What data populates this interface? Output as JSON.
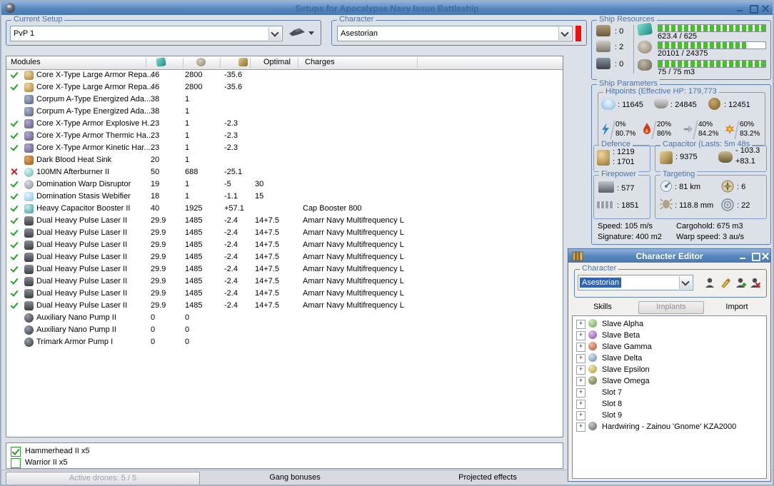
{
  "window": {
    "title": "Setups for Apocalypse Navy Issue Battleship",
    "setup_group": {
      "label": "Current Setup",
      "value": "PvP 1"
    },
    "character_group": {
      "label": "Character",
      "value": "Asestorian"
    },
    "modules": {
      "header": {
        "modules": "Modules",
        "optimal": "Optimal",
        "charges": "Charges",
        "icons": [
          "cpu-icon",
          "powergrid-icon",
          "capacitor-icon"
        ]
      },
      "rows": [
        {
          "s": "ok",
          "i": "rep",
          "n": "Core X-Type Large Armor Repa...",
          "cpu": "46",
          "pg": "2800",
          "cap": "-35.6",
          "opt": "",
          "chg": ""
        },
        {
          "s": "ok",
          "i": "rep",
          "n": "Core X-Type Large Armor Repa...",
          "cpu": "46",
          "pg": "2800",
          "cap": "-35.6",
          "opt": "",
          "chg": ""
        },
        {
          "s": "",
          "i": "mem",
          "n": "Corpum A-Type Energized Ada...",
          "cpu": "38",
          "pg": "1",
          "cap": "",
          "opt": "",
          "chg": ""
        },
        {
          "s": "",
          "i": "mem",
          "n": "Corpum A-Type Energized Ada...",
          "cpu": "38",
          "pg": "1",
          "cap": "",
          "opt": "",
          "chg": ""
        },
        {
          "s": "ok",
          "i": "hard",
          "n": "Core X-Type Armor Explosive H...",
          "cpu": "23",
          "pg": "1",
          "cap": "-2.3",
          "opt": "",
          "chg": ""
        },
        {
          "s": "ok",
          "i": "hard",
          "n": "Core X-Type Armor Thermic Ha...",
          "cpu": "23",
          "pg": "1",
          "cap": "-2.3",
          "opt": "",
          "chg": ""
        },
        {
          "s": "ok",
          "i": "hard",
          "n": "Core X-Type Armor Kinetic Har...",
          "cpu": "23",
          "pg": "1",
          "cap": "-2.3",
          "opt": "",
          "chg": ""
        },
        {
          "s": "",
          "i": "hs",
          "n": "Dark Blood Heat Sink",
          "cpu": "20",
          "pg": "1",
          "cap": "",
          "opt": "",
          "chg": ""
        },
        {
          "s": "bad",
          "i": "ab",
          "n": "100MN Afterburner II",
          "cpu": "50",
          "pg": "688",
          "cap": "-25.1",
          "opt": "",
          "chg": ""
        },
        {
          "s": "ok",
          "i": "wd",
          "n": "Domination Warp Disruptor",
          "cpu": "19",
          "pg": "1",
          "cap": "-5",
          "opt": "30",
          "chg": ""
        },
        {
          "s": "ok",
          "i": "web",
          "n": "Domination Stasis Webifier",
          "cpu": "18",
          "pg": "1",
          "cap": "-1.1",
          "opt": "15",
          "chg": ""
        },
        {
          "s": "ok",
          "i": "cbst",
          "n": "Heavy Capacitor Booster II",
          "cpu": "40",
          "pg": "1925",
          "cap": "+57.1",
          "opt": "",
          "chg": "Cap Booster 800"
        },
        {
          "s": "ok",
          "i": "laser",
          "n": "Dual Heavy Pulse Laser II",
          "cpu": "29.9",
          "pg": "1485",
          "cap": "-2.4",
          "opt": "14+7.5",
          "chg": "Amarr Navy Multifrequency L"
        },
        {
          "s": "ok",
          "i": "laser",
          "n": "Dual Heavy Pulse Laser II",
          "cpu": "29.9",
          "pg": "1485",
          "cap": "-2.4",
          "opt": "14+7.5",
          "chg": "Amarr Navy Multifrequency L"
        },
        {
          "s": "ok",
          "i": "laser",
          "n": "Dual Heavy Pulse Laser II",
          "cpu": "29.9",
          "pg": "1485",
          "cap": "-2.4",
          "opt": "14+7.5",
          "chg": "Amarr Navy Multifrequency L"
        },
        {
          "s": "ok",
          "i": "laser",
          "n": "Dual Heavy Pulse Laser II",
          "cpu": "29.9",
          "pg": "1485",
          "cap": "-2.4",
          "opt": "14+7.5",
          "chg": "Amarr Navy Multifrequency L"
        },
        {
          "s": "ok",
          "i": "laser",
          "n": "Dual Heavy Pulse Laser II",
          "cpu": "29.9",
          "pg": "1485",
          "cap": "-2.4",
          "opt": "14+7.5",
          "chg": "Amarr Navy Multifrequency L"
        },
        {
          "s": "ok",
          "i": "laser",
          "n": "Dual Heavy Pulse Laser II",
          "cpu": "29.9",
          "pg": "1485",
          "cap": "-2.4",
          "opt": "14+7.5",
          "chg": "Amarr Navy Multifrequency L"
        },
        {
          "s": "ok",
          "i": "laser",
          "n": "Dual Heavy Pulse Laser II",
          "cpu": "29.9",
          "pg": "1485",
          "cap": "-2.4",
          "opt": "14+7.5",
          "chg": "Amarr Navy Multifrequency L"
        },
        {
          "s": "ok",
          "i": "laser",
          "n": "Dual Heavy Pulse Laser II",
          "cpu": "29.9",
          "pg": "1485",
          "cap": "-2.4",
          "opt": "14+7.5",
          "chg": "Amarr Navy Multifrequency L"
        },
        {
          "s": "",
          "i": "rig",
          "n": "Auxiliary Nano Pump II",
          "cpu": "0",
          "pg": "0",
          "cap": "",
          "opt": "",
          "chg": ""
        },
        {
          "s": "",
          "i": "rig",
          "n": "Auxiliary Nano Pump II",
          "cpu": "0",
          "pg": "0",
          "cap": "",
          "opt": "",
          "chg": ""
        },
        {
          "s": "",
          "i": "rig",
          "n": "Trimark Armor Pump I",
          "cpu": "0",
          "pg": "0",
          "cap": "",
          "opt": "",
          "chg": ""
        }
      ]
    },
    "drones": [
      {
        "checked": true,
        "label": "Hammerhead II x5"
      },
      {
        "checked": false,
        "label": "Warrior II x5"
      }
    ],
    "bottom_bar": {
      "active_drones": "Active drones: 5 / 5",
      "gang_bonuses": "Gang bonuses",
      "projected_effects": "Projected effects"
    },
    "ship_resources": {
      "label": "Ship Resources",
      "turrets": ": 0",
      "launchers": ": 2",
      "rigs": ": 0",
      "cpu": {
        "text": "623.4 / 625",
        "pct": 99.7
      },
      "powergrid": {
        "text": "20101 / 24375",
        "pct": 82.5
      },
      "dronebay": {
        "text": "75 / 75 m3",
        "pct": 100
      }
    },
    "ship_parameters": {
      "label": "Ship Parameters",
      "hitpoints": {
        "label": "Hitpoints (Effective HP: 179,773",
        "shield": ": 11645",
        "armor": ": 24845",
        "structure": ": 12451",
        "resists": [
          {
            "icon": "em-icon",
            "top": "0%",
            "bottom": "80.7%"
          },
          {
            "icon": "thermal-icon",
            "top": "20%",
            "bottom": "86%"
          },
          {
            "icon": "kinetic-icon",
            "top": "40%",
            "bottom": "84.2%"
          },
          {
            "icon": "explosive-icon",
            "top": "60%",
            "bottom": "83.2%"
          }
        ]
      },
      "defence": {
        "label": "Defence",
        "v1": ": 1219",
        "v2": ": 1701"
      },
      "capacitor": {
        "label": "Capacitor (Lasts: 5m 48s",
        "amount": ": 9375",
        "drain": "- 103.3",
        "recharge": "+83.1"
      },
      "firepower": {
        "label": "Firepower",
        "dps": ": 577",
        "volley": ": 1851"
      },
      "targeting": {
        "label": "Targeting",
        "range": ": 81 km",
        "max_targets": ": 6",
        "signature_res": ": 118.8 mm",
        "scan_res": ": 22"
      },
      "speed": "Speed: 105 m/s",
      "signature": "Signature: 400 m2",
      "cargohold": "Cargohold: 675 m3",
      "warp_speed": "Warp speed: 3 au/s"
    }
  },
  "character_editor": {
    "title": "Character Editor",
    "group_label": "Character",
    "selected_character": "Asestorian",
    "tabs": {
      "skills": "Skills",
      "implants": "Implants",
      "import": "Import"
    },
    "implants": [
      {
        "icon": "head-green",
        "label": "Slave Alpha"
      },
      {
        "icon": "head-purple",
        "label": "Slave Beta"
      },
      {
        "icon": "head-red",
        "label": "Slave Gamma"
      },
      {
        "icon": "head-blue",
        "label": "Slave Delta"
      },
      {
        "icon": "head-yellow",
        "label": "Slave Epsilon"
      },
      {
        "icon": "head-olive",
        "label": "Slave Omega"
      },
      {
        "icon": "",
        "label": "Slot 7"
      },
      {
        "icon": "",
        "label": "Slot 8"
      },
      {
        "icon": "",
        "label": "Slot 9"
      },
      {
        "icon": "head-gray",
        "label": "Hardwiring - Zainou 'Gnome' KZA2000"
      }
    ]
  }
}
